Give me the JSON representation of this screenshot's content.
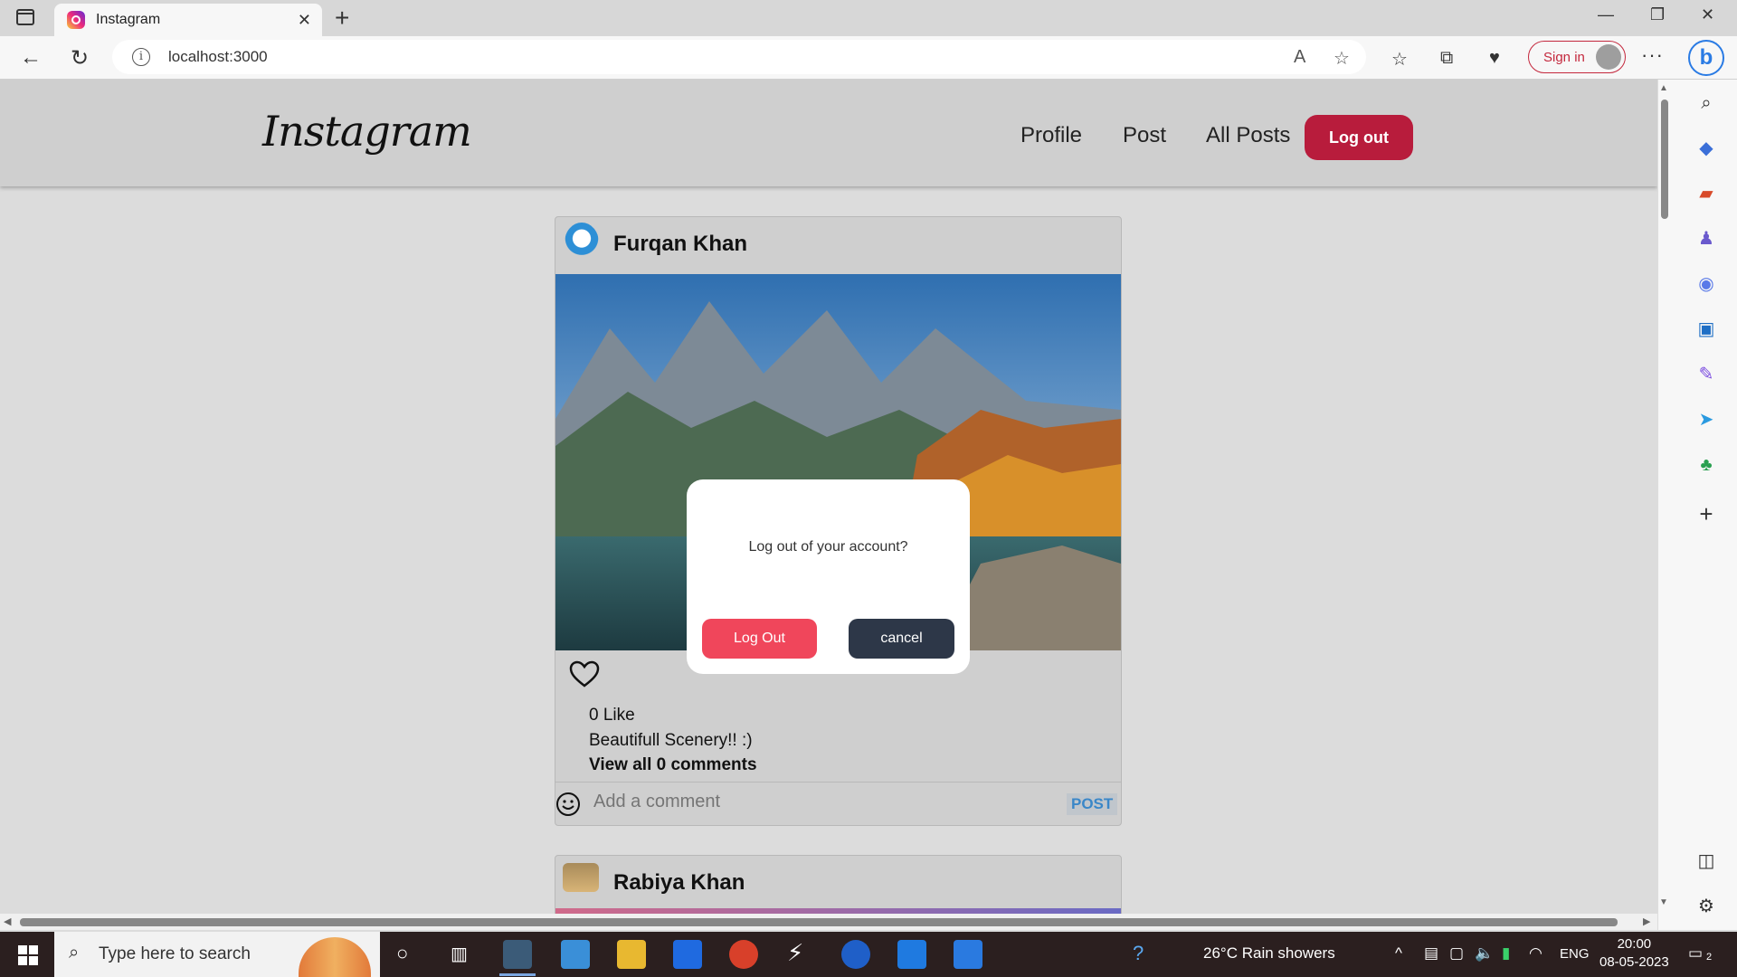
{
  "browser": {
    "tab_title": "Instagram",
    "url": "localhost:3000",
    "signin_label": "Sign in"
  },
  "app": {
    "logo": "Instagram",
    "nav": {
      "profile": "Profile",
      "post": "Post",
      "all_posts": "All Posts",
      "logout": "Log out"
    }
  },
  "posts": [
    {
      "author": "Furqan Khan",
      "likes": "0 Like",
      "caption": "Beautifull Scenery!! :)",
      "view_comments": "View all 0 comments",
      "comment_placeholder": "Add a comment",
      "post_button": "POST"
    },
    {
      "author": "Rabiya Khan"
    }
  ],
  "modal": {
    "message": "Log out of your account?",
    "confirm_label": "Log Out",
    "cancel_label": "cancel"
  },
  "taskbar": {
    "search_placeholder": "Type here to search",
    "weather": "26°C  Rain showers",
    "language": "ENG",
    "time": "20:00",
    "date": "08-05-2023",
    "notification_count": "2"
  },
  "colors": {
    "nav_logout": "#b81c3c",
    "modal_confirm": "#f0465b",
    "modal_cancel": "#2d3748",
    "post_button_text": "#3a87c8"
  }
}
